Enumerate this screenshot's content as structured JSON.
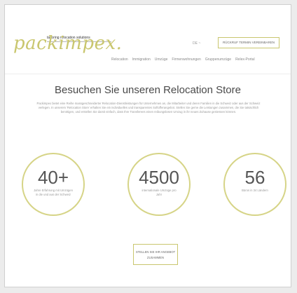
{
  "header": {
    "logo_text": "packimpex.",
    "tagline": "tailoring relocation solutions",
    "language": "DE ~",
    "cta_label": "RÜCKRUF TERMIN VEREINBAREN",
    "nav": [
      "Relocation",
      "Immigration",
      "Umzüge",
      "Firmenwohnungen",
      "Gruppenumzüge",
      "Relex-Portal"
    ]
  },
  "main": {
    "title": "Besuchen Sie unseren Relocation Store",
    "intro": "Packimpex bietet eine Reihe massgeschneiderter Relocation-Dienstleistungen für Unternehmen an, die Mitarbeiter und deren Familien in die Schweiz oder aus der Schweiz verlegen. In unserem 'Relocation Store' erhalten Sie ein individuelles und transparentes Softofferangebot. Stellen Sie gerne die Leistungen zusammen, die Sie tatsächlich benötigen, und erstellen Sie damit einfach, dass Ihre Transferees einen reibungslosen Umzug in ihr neues Zuhause geniessen können.",
    "stats": [
      {
        "value": "40+",
        "label": "Jahre Erfahrung mit Umzügen in die und aus der Schweiz"
      },
      {
        "value": "4500",
        "label": "internationale Umzüge pro Jahr"
      },
      {
        "value": "56",
        "label": "Büros in 34 Ländern"
      }
    ],
    "cta_label": "STELLEN SIE IHR ANGEBOT ZUSAMMEN"
  },
  "colors": {
    "accent": "#c9c66e",
    "circle": "#d6d487"
  }
}
